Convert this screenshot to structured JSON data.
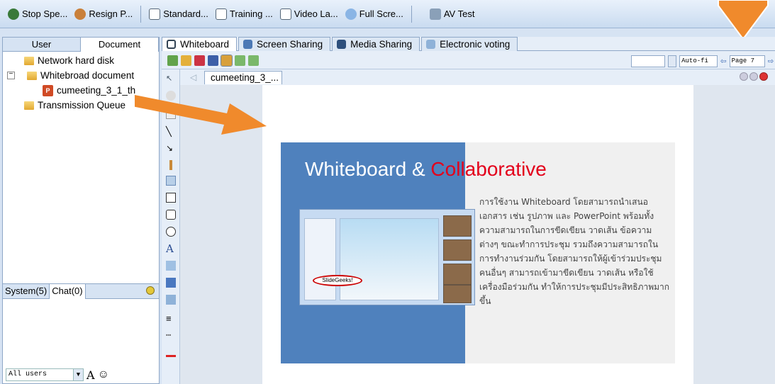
{
  "topbar": {
    "items": [
      {
        "label": "Stop Spe...",
        "icon": "stop-speaking-icon"
      },
      {
        "label": "Resign P...",
        "icon": "resign-presenter-icon"
      },
      {
        "label": "Standard...",
        "icon": "standard-layout-icon"
      },
      {
        "label": "Training ...",
        "icon": "training-layout-icon"
      },
      {
        "label": "Video La...",
        "icon": "video-layout-icon"
      },
      {
        "label": "Full Scre...",
        "icon": "fullscreen-icon"
      },
      {
        "label": "AV Test",
        "icon": "av-test-icon"
      }
    ]
  },
  "left_panel": {
    "tabs": [
      "User",
      "Document"
    ],
    "active_tab": "Document",
    "tree": [
      {
        "label": "Network hard disk",
        "icon": "folder-icon"
      },
      {
        "label": "Whitebroad document",
        "icon": "folder-icon"
      },
      {
        "label": "cumeeting_3_1_th",
        "icon": "ppt-file-icon"
      },
      {
        "label": "Transmission Queue",
        "icon": "folder-icon"
      }
    ],
    "chat_tabs": [
      "System(5)",
      "Chat(0)"
    ],
    "recipient": "All users",
    "font_button": "A",
    "emoji_button": "☺"
  },
  "main": {
    "tabs": [
      "Whiteboard",
      "Screen Sharing",
      "Media Sharing",
      "Electronic voting"
    ],
    "active_tab": "Whiteboard",
    "zoom": "Auto-fi",
    "page": "Page 7",
    "doc_tab": "cumeeting_3_...",
    "slide": {
      "title_part1": "Whiteboard & ",
      "title_red_c": "C",
      "title_rest": "ollaborative",
      "body": "การใช้งาน Whiteboard โดยสามารถนำเสนอเอกสาร เช่น รูปภาพ และ PowerPoint พร้อมทั้งความสามารถในการขีดเขียน วาดเส้น ข้อความต่างๆ ขณะทำการประชุม รวมถึงความสามารถในการทำงานร่วมกัน โดยสามารถให้ผู้เข้าร่วมประชุมคนอื่นๆ สามารถเข้ามาขีดเขียน วาดเส้น หรือใช้เครื่องมือร่วมกัน ทำให้การประชุมมีประสิทธิภาพมากขึ้น",
      "badge": "SlideGeeks!"
    }
  },
  "colors": {
    "accent": "#4f81bd",
    "arrow": "#f08a2c",
    "title_red": "#e3001b"
  }
}
